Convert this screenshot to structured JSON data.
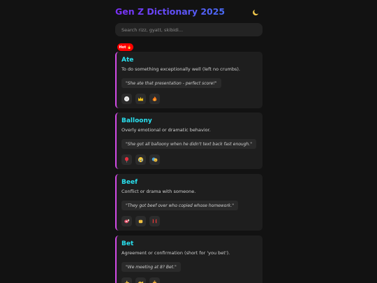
{
  "header": {
    "title": "Gen Z Dictionary 2025",
    "theme_icon": "moon-icon"
  },
  "search": {
    "placeholder": "Search rizz, gyatt, skibidi..."
  },
  "badge": {
    "label": "Hot 🔥"
  },
  "colors": {
    "accent_term": "#29e1f0",
    "card_border": "#d24be6",
    "title_gradient_start": "#7b2ff7",
    "title_gradient_end": "#4a6cf7",
    "badge": "#ff0000"
  },
  "entries": [
    {
      "term": "Ate",
      "definition": "To do something exceptionally well (left no crumbs).",
      "example": "\"She ate that presentation - perfect score!\"",
      "reactions": [
        "plate-icon",
        "crown-icon",
        "fire-icon"
      ]
    },
    {
      "term": "Balloony",
      "definition": "Overly emotional or dramatic behavior.",
      "example": "\"She got all balloony when he didn't text back fast enough.\"",
      "reactions": [
        "balloon-icon",
        "crying-face-icon",
        "theater-masks-icon"
      ]
    },
    {
      "term": "Beef",
      "definition": "Conflict or drama with someone.",
      "example": "\"They got beef over who copied whose homework.\"",
      "reactions": [
        "meat-icon",
        "fist-icon",
        "anger-icon"
      ]
    },
    {
      "term": "Bet",
      "definition": "Agreement or confirmation (short for 'you bet').",
      "example": "\"We meeting at 8? Bet.\"",
      "reactions": [
        "thumbs-up-icon",
        "handshake-icon",
        "money-bag-icon"
      ]
    }
  ]
}
